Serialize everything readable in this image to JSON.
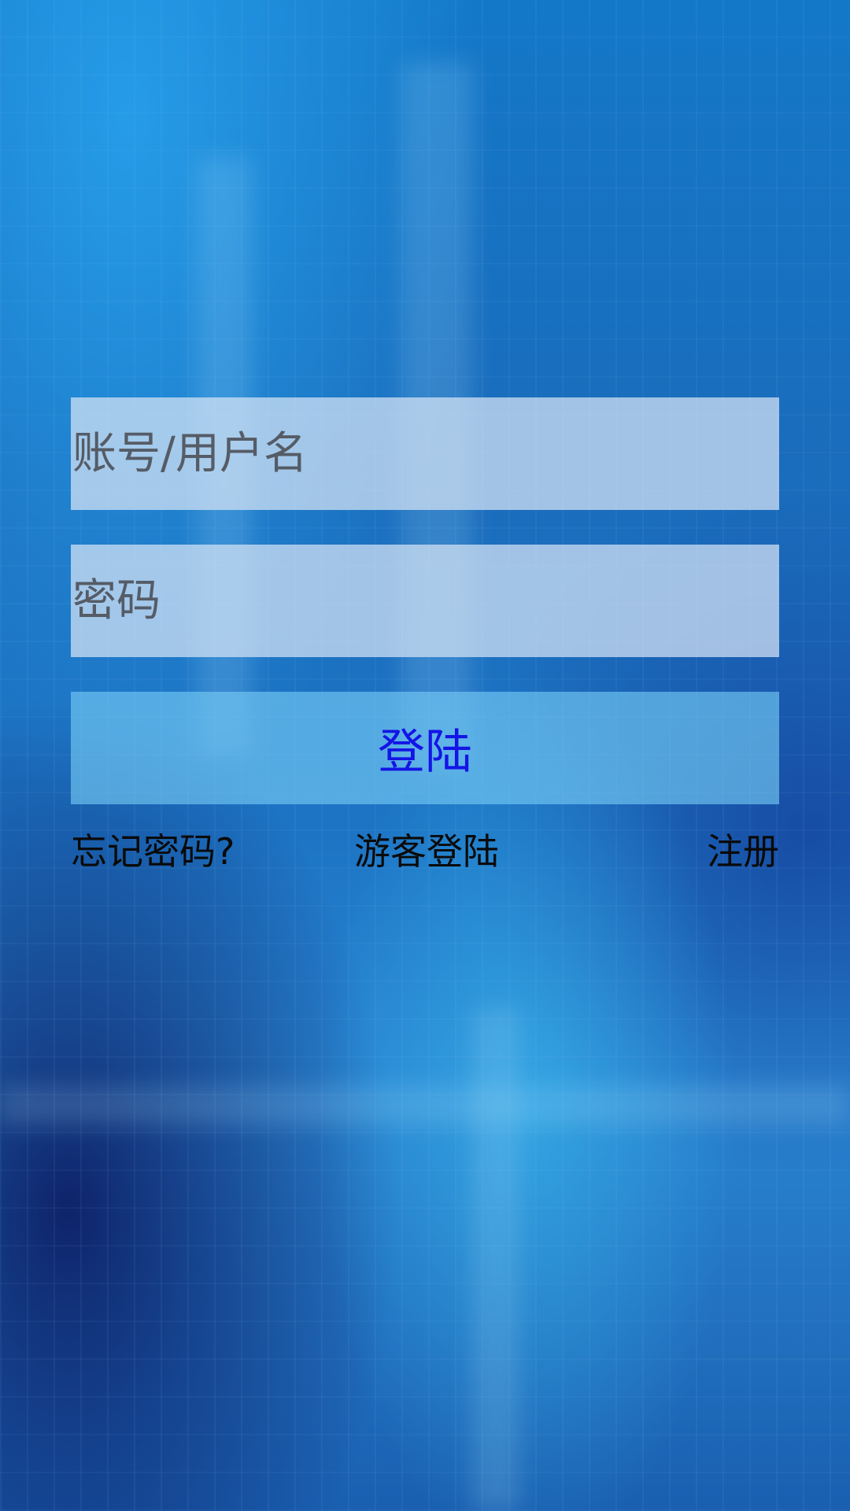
{
  "login_form": {
    "username_placeholder": "账号/用户名",
    "password_placeholder": "密码",
    "login_label": "登陆"
  },
  "links": {
    "forgot_password": "忘记密码?",
    "guest_login": "游客登陆",
    "register": "注册"
  },
  "colors": {
    "login_text": "#1414e6",
    "link_text": "#0a0a0a",
    "background": "#1a6cbc"
  }
}
